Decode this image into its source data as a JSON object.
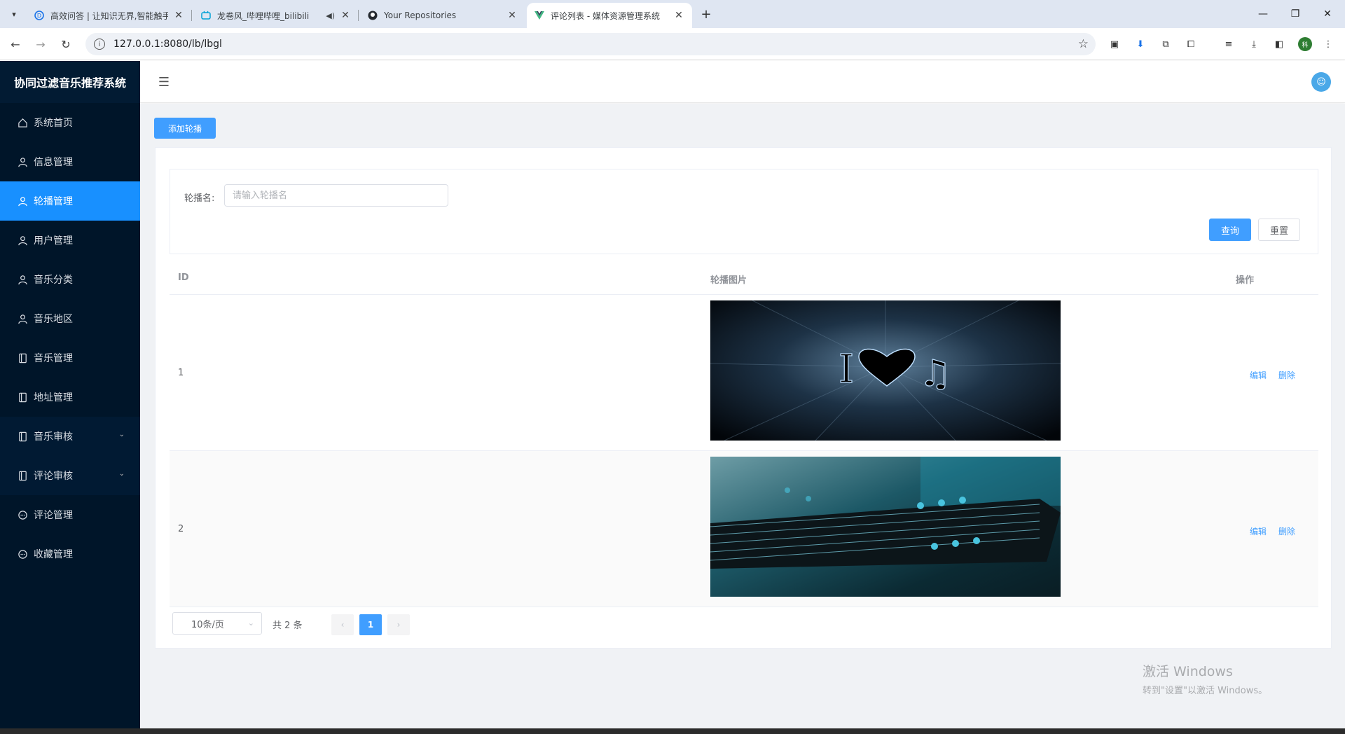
{
  "browser": {
    "tabs": [
      {
        "title": "高效问答 | 让知识无界,智能触手",
        "icon": "chat-icon",
        "active": false
      },
      {
        "title": "龙卷风_哔哩哔哩_bilibili",
        "icon": "bilibili-icon",
        "active": false,
        "audio": "speaker-icon"
      },
      {
        "title": "Your Repositories",
        "icon": "github-icon",
        "active": false
      },
      {
        "title": "评论列表 - 媒体资源管理系统",
        "icon": "vue-icon",
        "active": true
      }
    ],
    "url": "127.0.0.1:8080/lb/lbgl",
    "profile_initial": "科"
  },
  "sidebar": {
    "brand": "协同过滤音乐推荐系统",
    "items": [
      {
        "label": "系统首页",
        "icon": "home-icon"
      },
      {
        "label": "信息管理",
        "icon": "user-icon"
      },
      {
        "label": "轮播管理",
        "icon": "user-icon",
        "active": true
      },
      {
        "label": "用户管理",
        "icon": "user-icon"
      },
      {
        "label": "音乐分类",
        "icon": "user-icon"
      },
      {
        "label": "音乐地区",
        "icon": "user-icon"
      },
      {
        "label": "音乐管理",
        "icon": "notebook-icon"
      },
      {
        "label": "地址管理",
        "icon": "notebook-icon"
      },
      {
        "label": "音乐审核",
        "icon": "notebook-icon",
        "submenu": true
      },
      {
        "label": "评论审核",
        "icon": "notebook-icon",
        "submenu": true
      },
      {
        "label": "评论管理",
        "icon": "chat-bubble-icon"
      },
      {
        "label": "收藏管理",
        "icon": "chat-bubble-icon"
      }
    ]
  },
  "toolbar": {
    "add_label": "添加轮播"
  },
  "search": {
    "label": "轮播名:",
    "placeholder": "请输入轮播名",
    "query_label": "查询",
    "reset_label": "重置"
  },
  "table": {
    "headers": [
      "ID",
      "轮播图片",
      "操作"
    ],
    "rows": [
      {
        "id": "1",
        "image": "i-heart-music-banner",
        "edit": "编辑",
        "delete": "删除"
      },
      {
        "id": "2",
        "image": "guitar-neck-banner",
        "edit": "编辑",
        "delete": "删除"
      }
    ]
  },
  "pagination": {
    "page_size": "10条/页",
    "total": "共 2 条",
    "current_page": "1",
    "prev": "‹",
    "next": "›"
  },
  "watermark": {
    "line1": "激活 Windows",
    "line2": "转到\"设置\"以激活 Windows。"
  },
  "colors": {
    "primary": "#409eff",
    "sidebar_bg": "#001529",
    "active_menu": "#1890ff"
  }
}
